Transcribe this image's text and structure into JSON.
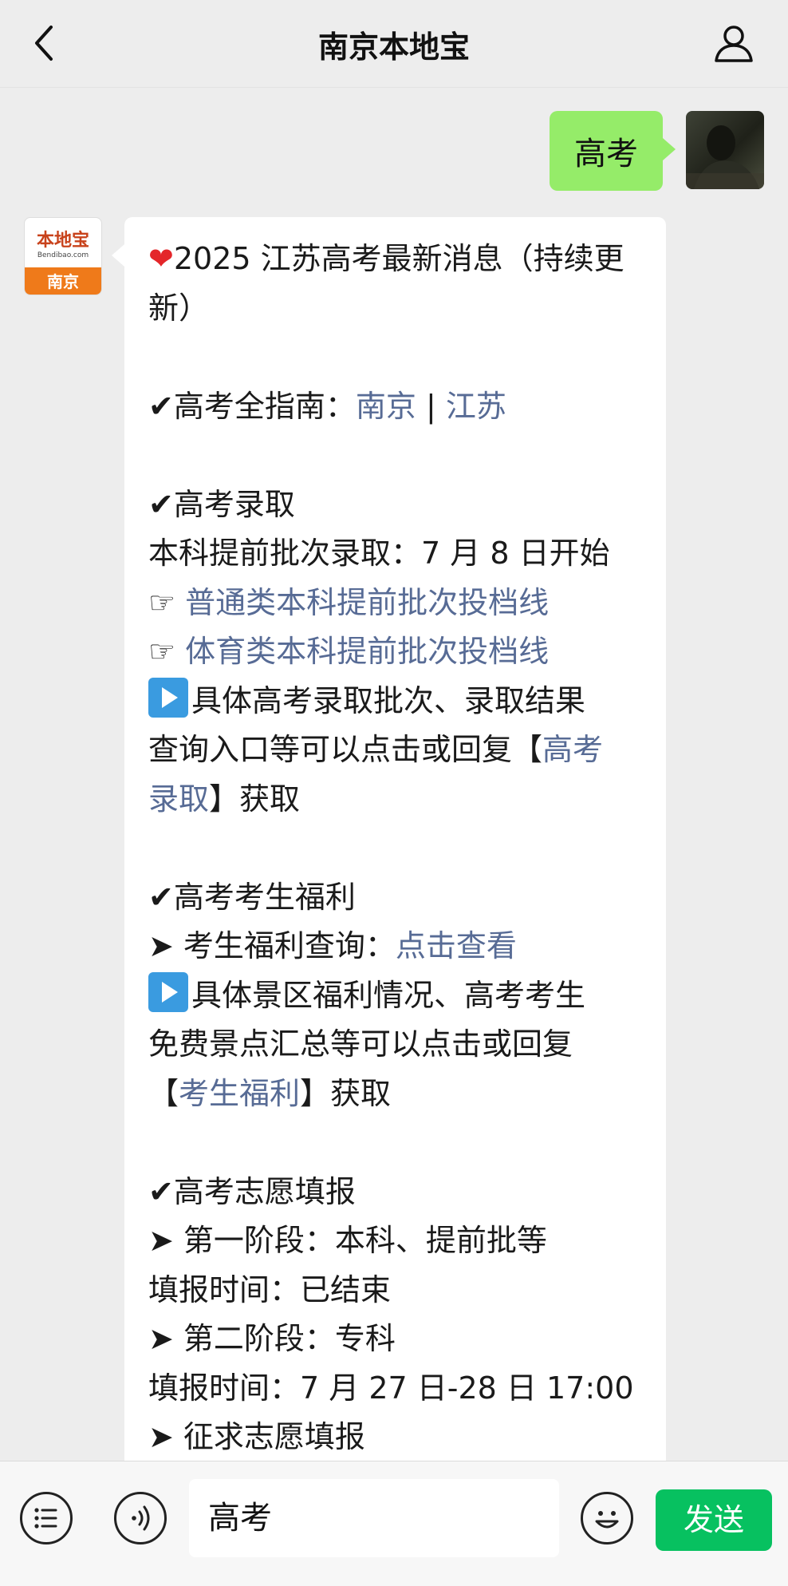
{
  "header": {
    "title": "南京本地宝"
  },
  "chat": {
    "me": {
      "text": "高考"
    },
    "bot": {
      "avatar": {
        "logo_text": "本地宝",
        "domain_text": "Bendibao.com",
        "city": "南京"
      },
      "lines": {
        "l1a": "2025 江苏高考最新消息（持续",
        "l1b": "更新）",
        "l2_pre": "✔高考全指南：",
        "l2_link1": "南京",
        "l2_sep": " | ",
        "l2_link2": "江苏",
        "l3": "✔高考录取",
        "l4": "本科提前批次录取：7 月 8 日开始",
        "l5_pre": "☞ ",
        "l5_link": "普通类本科提前批次投档线",
        "l6_pre": "☞ ",
        "l6_link": "体育类本科提前批次投档线",
        "l7a": "具体高考录取批次、录取结果",
        "l7b_pre": "查询入口等可以点击或回复【",
        "l7b_link": "高考",
        "l7c_link": "录取",
        "l7c_post": "】获取",
        "l8": "✔高考考生福利",
        "l9_pre": "➤ 考生福利查询：",
        "l9_link": "点击查看",
        "l10a": "具体景区福利情况、高考考生",
        "l10b": "免费景点汇总等可以点击或回复",
        "l10c_pre": "【",
        "l10c_link": "考生福利",
        "l10c_post": "】获取",
        "l11": "✔高考志愿填报",
        "l12": "➤ 第一阶段：本科、提前批等",
        "l13": "填报时间：已结束",
        "l14": "➤ 第二阶段：专科",
        "l15": "填报时间：7 月 27 日-28 日 17:00",
        "l16": "➤ 征求志愿填报"
      }
    }
  },
  "bottom": {
    "input_value": "高考",
    "send_label": "发送"
  },
  "colors": {
    "link": "#576b95",
    "send": "#07c160",
    "my_bubble": "#95ec69"
  },
  "icons": [
    "back-arrow-icon",
    "person-icon",
    "heart-icon",
    "play-icon",
    "menu-list-icon",
    "voice-icon",
    "emoji-icon"
  ]
}
